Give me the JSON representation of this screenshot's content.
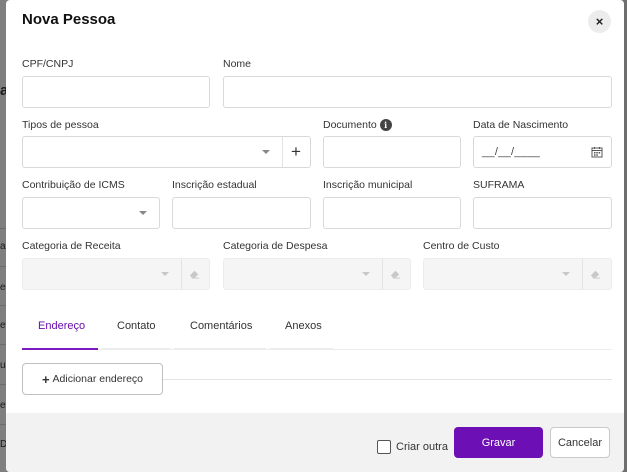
{
  "background": {
    "heading_fragment": "as",
    "row_fragments": [
      "ad",
      "ec",
      "ev",
      "ua",
      "eq",
      "D"
    ]
  },
  "modal": {
    "title": "Nova Pessoa",
    "close_icon": "close-icon",
    "close_glyph": "×"
  },
  "fields": {
    "cpf_cnpj": {
      "label": "CPF/CNPJ",
      "value": "",
      "placeholder": ""
    },
    "nome": {
      "label": "Nome",
      "value": "",
      "placeholder": ""
    },
    "tipos_pessoa": {
      "label": "Tipos de pessoa",
      "value": "",
      "add_glyph": "+"
    },
    "documento": {
      "label": "Documento",
      "info_icon": "info-icon",
      "info_glyph": "i",
      "value": ""
    },
    "data_nascimento": {
      "label": "Data de Nascimento",
      "mask": "__/__/____",
      "icon": "calendar-icon"
    },
    "contribuicao_icms": {
      "label": "Contribuição de ICMS",
      "value": ""
    },
    "inscricao_estadual": {
      "label": "Inscrição estadual",
      "value": ""
    },
    "inscricao_municipal": {
      "label": "Inscrição municipal",
      "value": ""
    },
    "suframa": {
      "label": "SUFRAMA",
      "value": ""
    },
    "categoria_receita": {
      "label": "Categoria de Receita",
      "value": ""
    },
    "categoria_despesa": {
      "label": "Categoria de Despesa",
      "value": ""
    },
    "centro_custo": {
      "label": "Centro de Custo",
      "value": ""
    }
  },
  "tabs": [
    {
      "label": "Endereço",
      "active": true
    },
    {
      "label": "Contato",
      "active": false
    },
    {
      "label": "Comentários",
      "active": false
    },
    {
      "label": "Anexos",
      "active": false
    }
  ],
  "address": {
    "add_glyph": "+",
    "add_label": "Adicionar endereço"
  },
  "footer": {
    "create_another_label": "Criar outra",
    "create_another_checked": false,
    "save_label": "Gravar",
    "cancel_label": "Cancelar"
  },
  "colors": {
    "accent": "#6c0fb4",
    "active_tab_text": "#6a0dad",
    "footer_bg": "#f2f2f2"
  }
}
